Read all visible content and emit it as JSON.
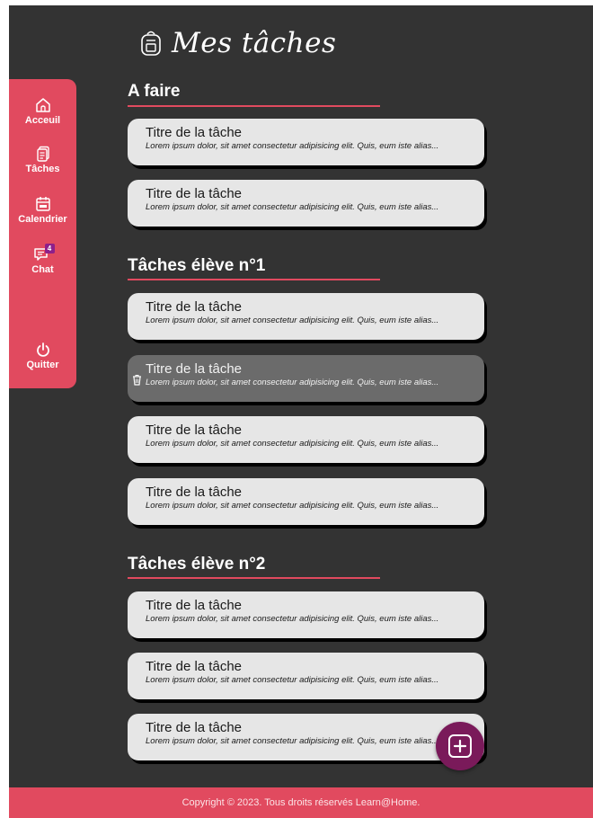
{
  "header": {
    "title": "Mes tâches",
    "icon": "backpack-icon"
  },
  "sidebar": {
    "items": [
      {
        "label": "Acceuil",
        "icon": "home-icon"
      },
      {
        "label": "Tâches",
        "icon": "tasks-icon"
      },
      {
        "label": "Calendrier",
        "icon": "calendar-icon"
      },
      {
        "label": "Chat",
        "icon": "chat-icon",
        "badge": "4"
      },
      {
        "label": "Quitter",
        "icon": "power-icon"
      }
    ]
  },
  "sections": [
    {
      "title": "A faire",
      "tasks": [
        {
          "title": "Titre de la tâche",
          "desc": "Lorem ipsum dolor, sit amet consectetur adipisicing elit. Quis, eum iste alias..."
        },
        {
          "title": "Titre de la tâche",
          "desc": "Lorem ipsum dolor, sit amet consectetur adipisicing elit. Quis, eum iste alias..."
        }
      ]
    },
    {
      "title": "Tâches élève n°1",
      "tasks": [
        {
          "title": "Titre de la tâche",
          "desc": "Lorem ipsum dolor, sit amet consectetur adipisicing elit. Quis, eum iste alias..."
        },
        {
          "title": "Titre de la tâche",
          "desc": "Lorem ipsum dolor, sit amet consectetur adipisicing elit. Quis, eum iste alias..."
        },
        {
          "title": "Titre de la tâche",
          "desc": "Lorem ipsum dolor, sit amet consectetur adipisicing elit. Quis, eum iste alias..."
        },
        {
          "title": "Titre de la tâche",
          "desc": "Lorem ipsum dolor, sit amet consectetur adipisicing elit. Quis, eum iste alias..."
        }
      ]
    },
    {
      "title": "Tâches élève n°2",
      "tasks": [
        {
          "title": "Titre de la tâche",
          "desc": "Lorem ipsum dolor, sit amet consectetur adipisicing elit. Quis, eum iste alias..."
        },
        {
          "title": "Titre de la tâche",
          "desc": "Lorem ipsum dolor, sit amet consectetur adipisicing elit. Quis, eum iste alias..."
        },
        {
          "title": "Titre de la tâche",
          "desc": "Lorem ipsum dolor, sit amet consectetur adipisicing elit. Quis, eum iste alias..."
        }
      ]
    }
  ],
  "fab": {
    "icon": "plus-icon"
  },
  "footer": {
    "text": "Copyright © 2023. Tous droits réservés Learn@Home."
  },
  "colors": {
    "accent": "#e14a5f",
    "background": "#333333",
    "card": "#e6e6e6",
    "card_selected": "#6b6b6b",
    "fab": "#7a1a5a"
  }
}
